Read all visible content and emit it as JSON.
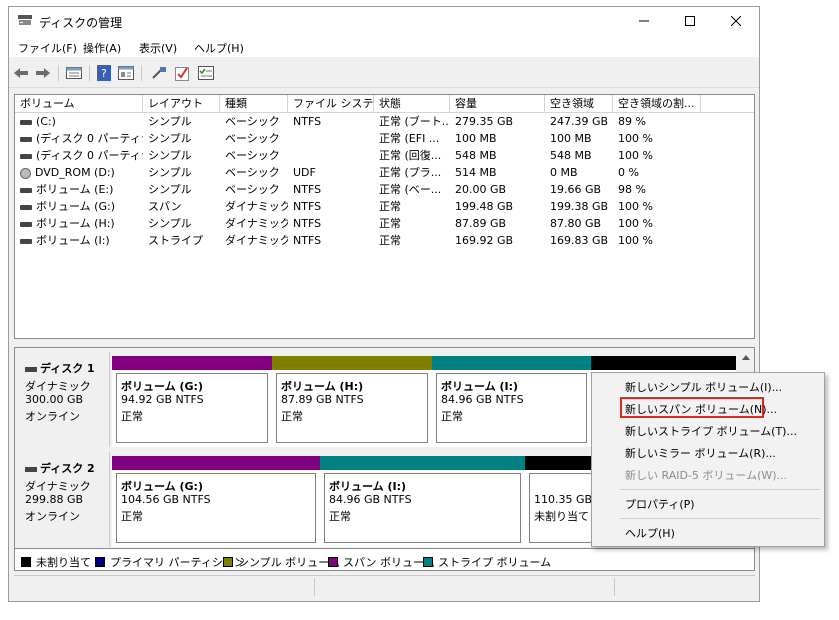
{
  "window": {
    "title": "ディスクの管理",
    "controls": {
      "minimize": "–",
      "maximize": "☐",
      "close": "✕"
    }
  },
  "menu": [
    "ファイル(F)",
    "操作(A)",
    "表示(V)",
    "ヘルプ(H)"
  ],
  "toolbar_icons": [
    "back-arrow-icon",
    "forward-arrow-icon",
    "disk-list-icon",
    "help-icon",
    "properties-icon",
    "connect-icon",
    "check-icon",
    "list-icon"
  ],
  "volumes": {
    "columns": [
      "ボリューム",
      "レイアウト",
      "種類",
      "ファイル システム",
      "状態",
      "容量",
      "空き領域",
      "空き領域の割..."
    ],
    "rows": [
      [
        "(C:)",
        "シンプル",
        "ベーシック",
        "NTFS",
        "正常 (ブート...",
        "279.35 GB",
        "247.39 GB",
        "89 %"
      ],
      [
        "(ディスク 0 パーティシ...",
        "シンプル",
        "ベーシック",
        "",
        "正常 (EFI ...",
        "100 MB",
        "100 MB",
        "100 %"
      ],
      [
        "(ディスク 0 パーティシ...",
        "シンプル",
        "ベーシック",
        "",
        "正常 (回復...",
        "548 MB",
        "548 MB",
        "100 %"
      ],
      [
        "DVD_ROM (D:)",
        "シンプル",
        "ベーシック",
        "UDF",
        "正常 (プラ...",
        "514 MB",
        "0 MB",
        "0 %"
      ],
      [
        "ボリューム (E:)",
        "シンプル",
        "ベーシック",
        "NTFS",
        "正常 (ベー...",
        "20.00 GB",
        "19.66 GB",
        "98 %"
      ],
      [
        "ボリューム (G:)",
        "スパン",
        "ダイナミック",
        "NTFS",
        "正常",
        "199.48 GB",
        "199.38 GB",
        "100 %"
      ],
      [
        "ボリューム (H:)",
        "シンプル",
        "ダイナミック",
        "NTFS",
        "正常",
        "87.89 GB",
        "87.80 GB",
        "100 %"
      ],
      [
        "ボリューム (I:)",
        "ストライプ",
        "ダイナミック",
        "NTFS",
        "正常",
        "169.92 GB",
        "169.83 GB",
        "100 %"
      ]
    ]
  },
  "disks": [
    {
      "name": "ディスク 1",
      "type": "ダイナミック",
      "size": "300.00 GB",
      "status": "オンライン",
      "partitions": [
        {
          "name": "ボリューム (G:)",
          "size": "94.92 GB NTFS",
          "status": "正常",
          "kind": "span"
        },
        {
          "name": "ボリューム (H:)",
          "size": "87.89 GB NTFS",
          "status": "正常",
          "kind": "simple"
        },
        {
          "name": "ボリューム (I:)",
          "size": "84.96 GB NTFS",
          "status": "正常",
          "kind": "stripe"
        },
        {
          "name": "",
          "size": "",
          "status": "",
          "kind": "unallocated"
        }
      ]
    },
    {
      "name": "ディスク 2",
      "type": "ダイナミック",
      "size": "299.88 GB",
      "status": "オンライン",
      "partitions": [
        {
          "name": "ボリューム (G:)",
          "size": "104.56 GB NTFS",
          "status": "正常",
          "kind": "span"
        },
        {
          "name": "ボリューム (I:)",
          "size": "84.96 GB NTFS",
          "status": "正常",
          "kind": "stripe"
        },
        {
          "name": "",
          "size": "110.35 GB",
          "status": "未割り当て",
          "kind": "unallocated"
        }
      ]
    }
  ],
  "legend": [
    {
      "label": "未割り当て",
      "color": "#000000"
    },
    {
      "label": "プライマリ パーティション",
      "color": "#000080"
    },
    {
      "label": "シンプル ボリューム",
      "color": "#808000"
    },
    {
      "label": "スパン ボリューム",
      "color": "#800080"
    },
    {
      "label": "ストライプ ボリューム",
      "color": "#008080"
    }
  ],
  "colors": {
    "span": "#800080",
    "simple": "#808000",
    "stripe": "#008080",
    "unallocated": "#000000",
    "highlight": "#e0281e"
  },
  "context_menu": [
    {
      "label": "新しいシンプル ボリューム(I)...",
      "enabled": true
    },
    {
      "label": "新しいスパン ボリューム(N)...",
      "enabled": true,
      "highlighted": true
    },
    {
      "label": "新しいストライプ ボリューム(T)...",
      "enabled": true
    },
    {
      "label": "新しいミラー ボリューム(R)...",
      "enabled": true
    },
    {
      "label": "新しい RAID-5 ボリューム(W)...",
      "enabled": false
    },
    {
      "label": "プロパティ(P)",
      "enabled": true
    },
    {
      "label": "ヘルプ(H)",
      "enabled": true
    }
  ]
}
